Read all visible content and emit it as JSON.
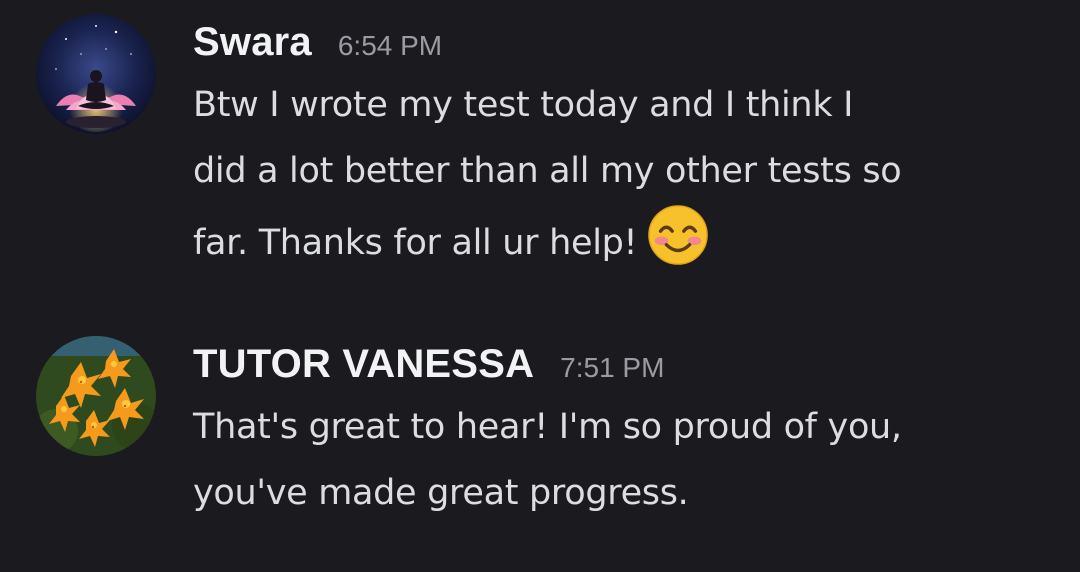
{
  "messages": [
    {
      "username": "Swara",
      "timestamp": "6:54 PM",
      "text_lines": [
        "Btw I wrote my test today and I think I",
        "did a lot better than all my other tests so",
        "far. Thanks for all ur help!"
      ],
      "emoji": "smiling-face-with-smiling-eyes-icon",
      "avatar": "meditation-lotus-avatar"
    },
    {
      "username": "TUTOR VANESSA",
      "timestamp": "7:51 PM",
      "text_lines": [
        "That's great to hear! I'm so proud of you,",
        "you've made great progress."
      ],
      "avatar": "orange-lilies-avatar"
    }
  ],
  "colors": {
    "background": "#1b1b1f",
    "username": "#f2f3f5",
    "timestamp": "#9a9ba3",
    "message_text": "#dcdde1"
  }
}
